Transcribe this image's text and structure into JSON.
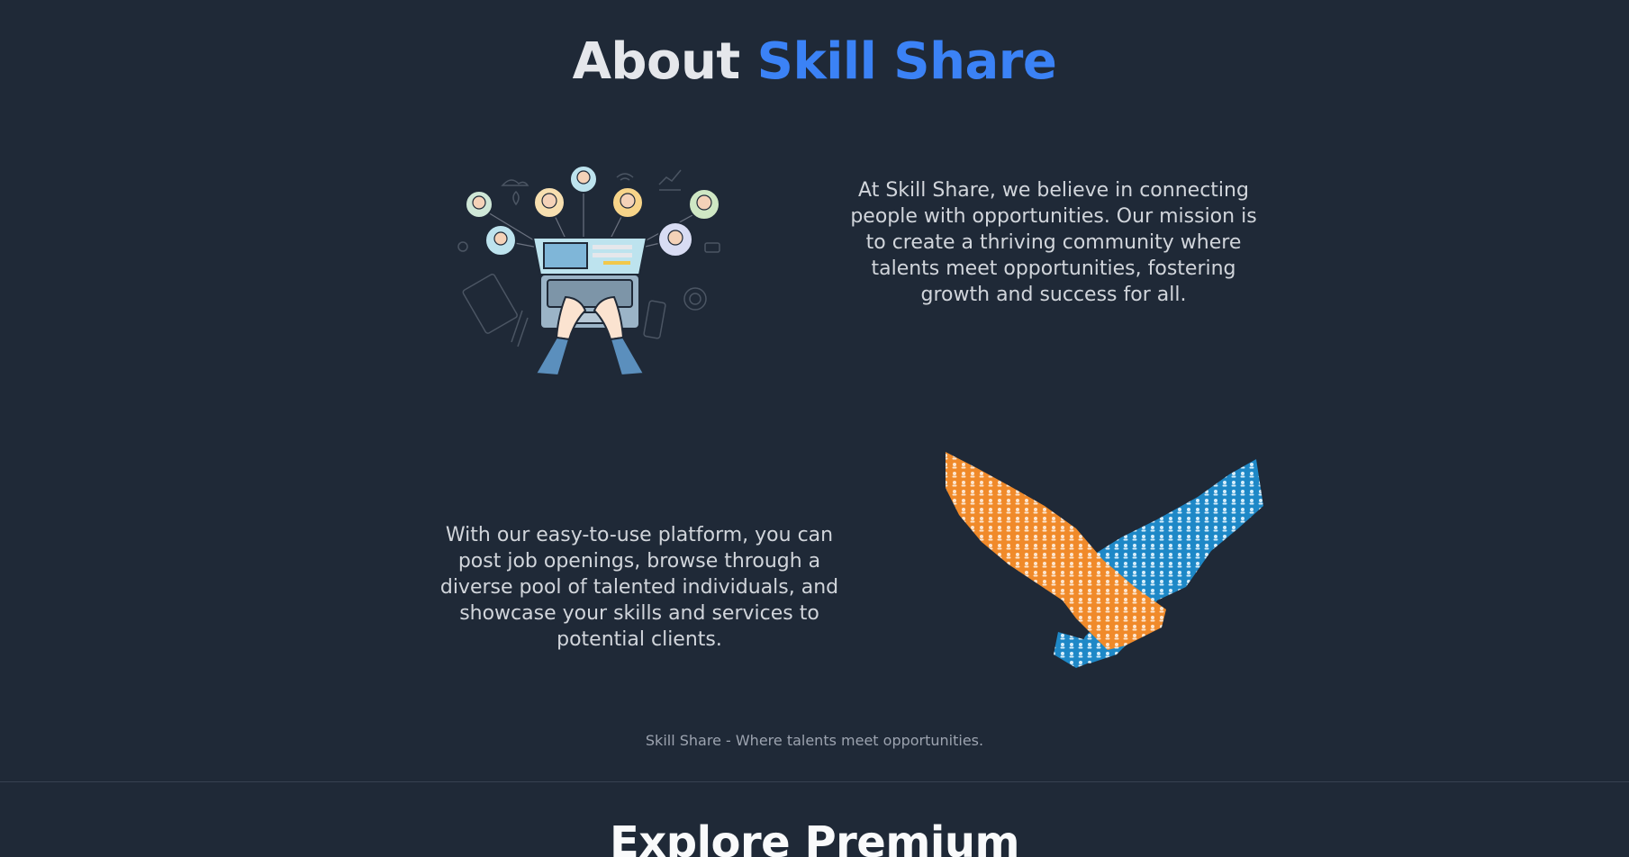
{
  "about": {
    "title_prefix": "About",
    "title_brand": "Skill Share",
    "paragraph_1": "At Skill Share, we believe in connecting people with opportunities. Our mission is to create a thriving community where talents meet opportunities, fostering growth and success for all.",
    "paragraph_2": "With our easy-to-use platform, you can post job openings, browse through a diverse pool of talented individuals, and showcase your skills and services to potential clients.",
    "tagline": "Skill Share - Where talents meet opportunities."
  },
  "next_section": {
    "title": "Explore Premium"
  },
  "colors": {
    "background": "#1f2937",
    "brand": "#3b82f6",
    "text": "#d1d5db",
    "handshake_left": "#f08a2a",
    "handshake_right": "#1e88c7"
  },
  "icons": {
    "illustration_1": "laptop-community-illustration",
    "illustration_2": "handshake-people-illustration"
  }
}
